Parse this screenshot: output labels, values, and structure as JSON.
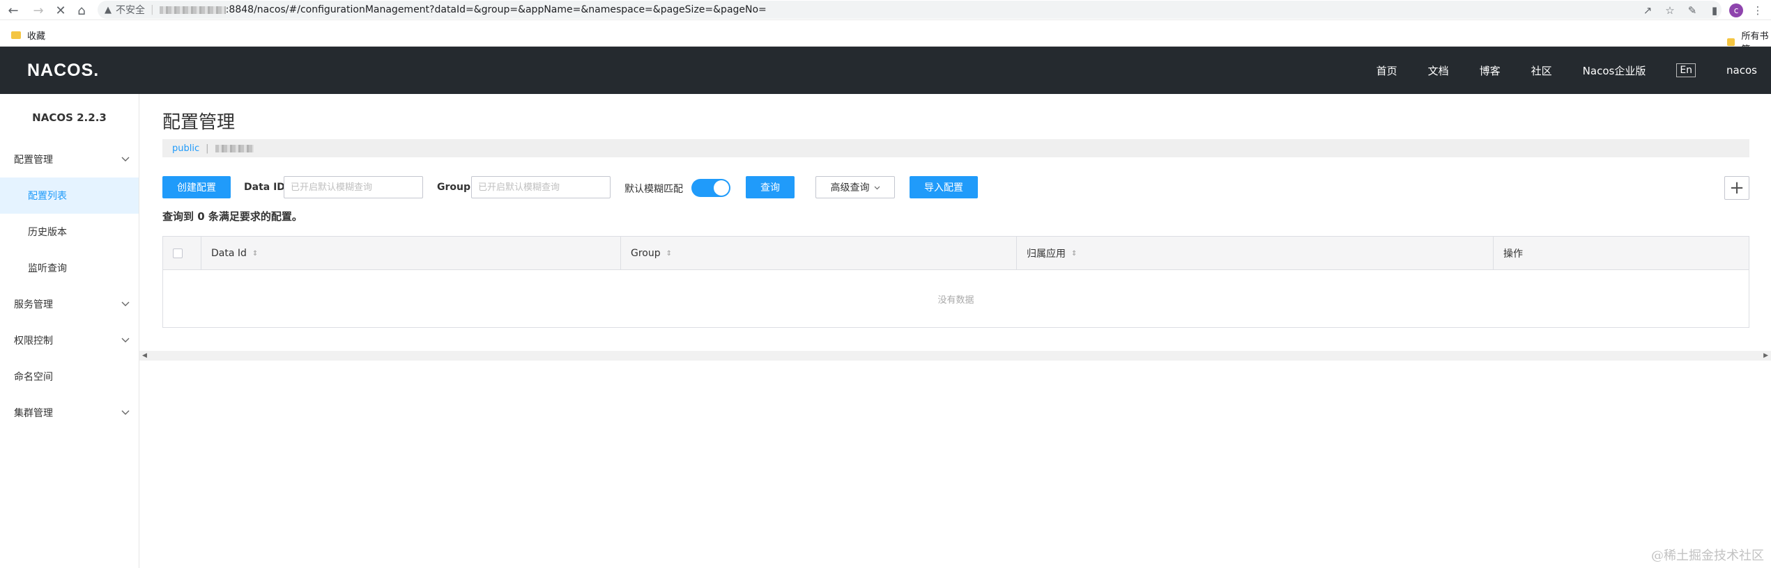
{
  "browser": {
    "insecure_label": "不安全",
    "url_suffix": ":8848/nacos/#/configurationManagement?dataId=&group=&appName=&namespace=&pageSize=&pageNo=",
    "profile_initial": "c",
    "bookmarks_left": "收藏",
    "bookmarks_right": "所有书签"
  },
  "header": {
    "logo": "NACOS.",
    "nav": [
      "首页",
      "文档",
      "博客",
      "社区",
      "Nacos企业版"
    ],
    "lang": "En",
    "user": "nacos"
  },
  "sidebar": {
    "version": "NACOS 2.2.3",
    "items": [
      {
        "label": "配置管理",
        "expandable": true
      },
      {
        "label": "配置列表",
        "sub": true,
        "active": true
      },
      {
        "label": "历史版本",
        "sub": true
      },
      {
        "label": "监听查询",
        "sub": true
      },
      {
        "label": "服务管理",
        "expandable": true
      },
      {
        "label": "权限控制",
        "expandable": true
      },
      {
        "label": "命名空间"
      },
      {
        "label": "集群管理",
        "expandable": true
      }
    ]
  },
  "main": {
    "title": "配置管理",
    "namespace": "public",
    "toolbar": {
      "create_label": "创建配置",
      "dataid_label": "Data ID",
      "dataid_placeholder": "已开启默认模糊查询",
      "group_label": "Group",
      "group_placeholder": "已开启默认模糊查询",
      "fuzzy_label": "默认模糊匹配",
      "fuzzy_on": true,
      "query_label": "查询",
      "advanced_label": "高级查询",
      "import_label": "导入配置",
      "plus": "+"
    },
    "result_text": "查询到 0 条满足要求的配置。",
    "table": {
      "columns": [
        "Data Id",
        "Group",
        "归属应用",
        "操作"
      ],
      "empty_text": "没有数据"
    }
  },
  "watermark": "@稀土掘金技术社区",
  "colors": {
    "accent": "#209bfa",
    "header_bg": "#252a2f",
    "active_bg": "#e5f3ff"
  }
}
